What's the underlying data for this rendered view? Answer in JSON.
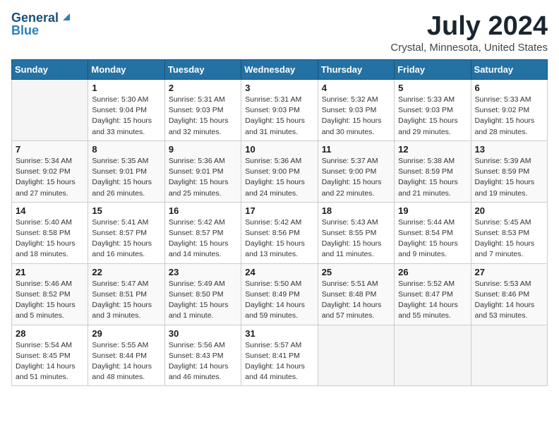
{
  "header": {
    "logo_line1": "General",
    "logo_line2": "Blue",
    "title": "July 2024",
    "subtitle": "Crystal, Minnesota, United States"
  },
  "calendar": {
    "days_of_week": [
      "Sunday",
      "Monday",
      "Tuesday",
      "Wednesday",
      "Thursday",
      "Friday",
      "Saturday"
    ],
    "weeks": [
      [
        {
          "day": "",
          "detail": ""
        },
        {
          "day": "1",
          "detail": "Sunrise: 5:30 AM\nSunset: 9:04 PM\nDaylight: 15 hours\nand 33 minutes."
        },
        {
          "day": "2",
          "detail": "Sunrise: 5:31 AM\nSunset: 9:03 PM\nDaylight: 15 hours\nand 32 minutes."
        },
        {
          "day": "3",
          "detail": "Sunrise: 5:31 AM\nSunset: 9:03 PM\nDaylight: 15 hours\nand 31 minutes."
        },
        {
          "day": "4",
          "detail": "Sunrise: 5:32 AM\nSunset: 9:03 PM\nDaylight: 15 hours\nand 30 minutes."
        },
        {
          "day": "5",
          "detail": "Sunrise: 5:33 AM\nSunset: 9:03 PM\nDaylight: 15 hours\nand 29 minutes."
        },
        {
          "day": "6",
          "detail": "Sunrise: 5:33 AM\nSunset: 9:02 PM\nDaylight: 15 hours\nand 28 minutes."
        }
      ],
      [
        {
          "day": "7",
          "detail": "Sunrise: 5:34 AM\nSunset: 9:02 PM\nDaylight: 15 hours\nand 27 minutes."
        },
        {
          "day": "8",
          "detail": "Sunrise: 5:35 AM\nSunset: 9:01 PM\nDaylight: 15 hours\nand 26 minutes."
        },
        {
          "day": "9",
          "detail": "Sunrise: 5:36 AM\nSunset: 9:01 PM\nDaylight: 15 hours\nand 25 minutes."
        },
        {
          "day": "10",
          "detail": "Sunrise: 5:36 AM\nSunset: 9:00 PM\nDaylight: 15 hours\nand 24 minutes."
        },
        {
          "day": "11",
          "detail": "Sunrise: 5:37 AM\nSunset: 9:00 PM\nDaylight: 15 hours\nand 22 minutes."
        },
        {
          "day": "12",
          "detail": "Sunrise: 5:38 AM\nSunset: 8:59 PM\nDaylight: 15 hours\nand 21 minutes."
        },
        {
          "day": "13",
          "detail": "Sunrise: 5:39 AM\nSunset: 8:59 PM\nDaylight: 15 hours\nand 19 minutes."
        }
      ],
      [
        {
          "day": "14",
          "detail": "Sunrise: 5:40 AM\nSunset: 8:58 PM\nDaylight: 15 hours\nand 18 minutes."
        },
        {
          "day": "15",
          "detail": "Sunrise: 5:41 AM\nSunset: 8:57 PM\nDaylight: 15 hours\nand 16 minutes."
        },
        {
          "day": "16",
          "detail": "Sunrise: 5:42 AM\nSunset: 8:57 PM\nDaylight: 15 hours\nand 14 minutes."
        },
        {
          "day": "17",
          "detail": "Sunrise: 5:42 AM\nSunset: 8:56 PM\nDaylight: 15 hours\nand 13 minutes."
        },
        {
          "day": "18",
          "detail": "Sunrise: 5:43 AM\nSunset: 8:55 PM\nDaylight: 15 hours\nand 11 minutes."
        },
        {
          "day": "19",
          "detail": "Sunrise: 5:44 AM\nSunset: 8:54 PM\nDaylight: 15 hours\nand 9 minutes."
        },
        {
          "day": "20",
          "detail": "Sunrise: 5:45 AM\nSunset: 8:53 PM\nDaylight: 15 hours\nand 7 minutes."
        }
      ],
      [
        {
          "day": "21",
          "detail": "Sunrise: 5:46 AM\nSunset: 8:52 PM\nDaylight: 15 hours\nand 5 minutes."
        },
        {
          "day": "22",
          "detail": "Sunrise: 5:47 AM\nSunset: 8:51 PM\nDaylight: 15 hours\nand 3 minutes."
        },
        {
          "day": "23",
          "detail": "Sunrise: 5:49 AM\nSunset: 8:50 PM\nDaylight: 15 hours\nand 1 minute."
        },
        {
          "day": "24",
          "detail": "Sunrise: 5:50 AM\nSunset: 8:49 PM\nDaylight: 14 hours\nand 59 minutes."
        },
        {
          "day": "25",
          "detail": "Sunrise: 5:51 AM\nSunset: 8:48 PM\nDaylight: 14 hours\nand 57 minutes."
        },
        {
          "day": "26",
          "detail": "Sunrise: 5:52 AM\nSunset: 8:47 PM\nDaylight: 14 hours\nand 55 minutes."
        },
        {
          "day": "27",
          "detail": "Sunrise: 5:53 AM\nSunset: 8:46 PM\nDaylight: 14 hours\nand 53 minutes."
        }
      ],
      [
        {
          "day": "28",
          "detail": "Sunrise: 5:54 AM\nSunset: 8:45 PM\nDaylight: 14 hours\nand 51 minutes."
        },
        {
          "day": "29",
          "detail": "Sunrise: 5:55 AM\nSunset: 8:44 PM\nDaylight: 14 hours\nand 48 minutes."
        },
        {
          "day": "30",
          "detail": "Sunrise: 5:56 AM\nSunset: 8:43 PM\nDaylight: 14 hours\nand 46 minutes."
        },
        {
          "day": "31",
          "detail": "Sunrise: 5:57 AM\nSunset: 8:41 PM\nDaylight: 14 hours\nand 44 minutes."
        },
        {
          "day": "",
          "detail": ""
        },
        {
          "day": "",
          "detail": ""
        },
        {
          "day": "",
          "detail": ""
        }
      ]
    ]
  }
}
